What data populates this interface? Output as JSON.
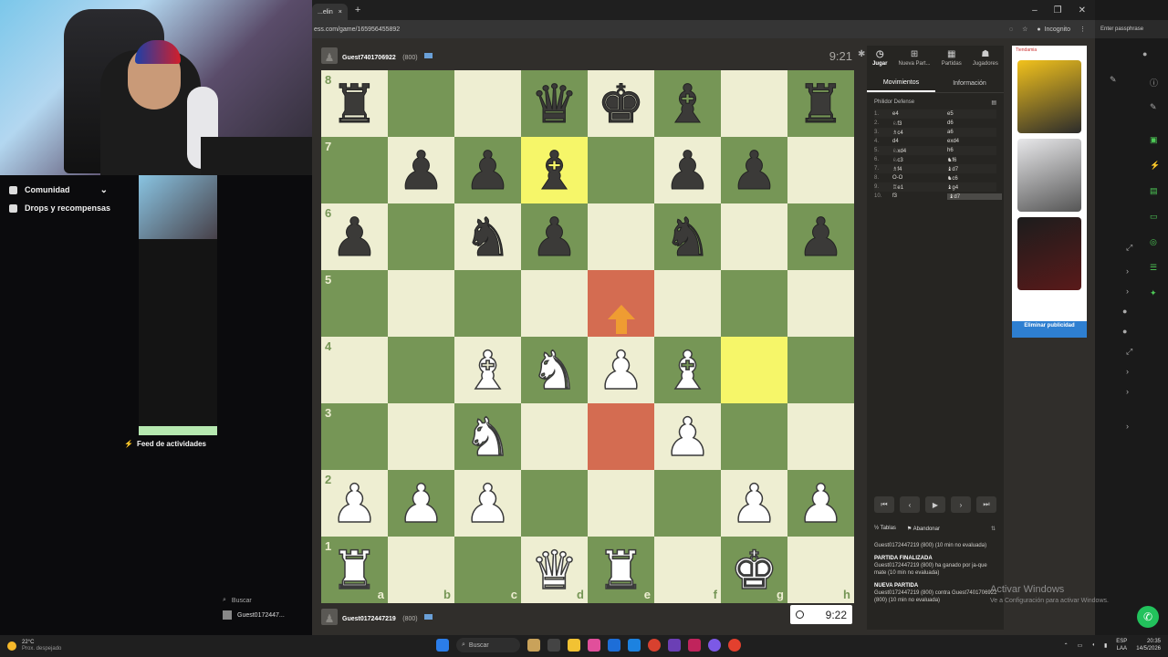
{
  "sidebar": {
    "items": [
      {
        "label": "Comunidad",
        "icon": "people-icon",
        "chevron": "⌄"
      },
      {
        "label": "Drops y recompensas",
        "icon": "gift-icon"
      }
    ],
    "feed_label": "Feed de actividades",
    "search_label": "Buscar",
    "search_user": "Guest0172447..."
  },
  "browser": {
    "tab_title": "...elin",
    "tab_close": "×",
    "new_tab": "+",
    "url": "ess.com/game/165956455892",
    "incognito": "Incognito",
    "window_controls": [
      "–",
      "❐",
      "✕"
    ],
    "passphrase": "Enter passphrase"
  },
  "players": {
    "top": {
      "name": "Guest7401706922",
      "rating": "(800)",
      "clock": "9:21"
    },
    "bottom": {
      "name": "Guest0172447219",
      "rating": "(800)",
      "clock": "9:22"
    }
  },
  "board": {
    "ranks": [
      "8",
      "7",
      "6",
      "5",
      "4",
      "3",
      "2",
      "1"
    ],
    "files": [
      "a",
      "b",
      "c",
      "d",
      "e",
      "f",
      "g",
      "h"
    ],
    "rows": [
      [
        "r",
        "",
        "",
        "q",
        "k",
        "b",
        "",
        "r"
      ],
      [
        "",
        "p",
        "p",
        "b",
        "",
        "p",
        "p",
        ""
      ],
      [
        "p",
        "",
        "n",
        "p",
        "",
        "n",
        "",
        "p"
      ],
      [
        "",
        "",
        "",
        "",
        "",
        "",
        "",
        ""
      ],
      [
        "",
        "",
        "B",
        "N",
        "P",
        "B",
        "",
        ""
      ],
      [
        "",
        "",
        "N",
        "",
        "",
        "P",
        "",
        ""
      ],
      [
        "P",
        "P",
        "P",
        "",
        "",
        "",
        "P",
        "P"
      ],
      [
        "R",
        "",
        "",
        "Q",
        "R",
        "",
        "K",
        ""
      ]
    ],
    "highlight_yellow": [
      "d7",
      "g4"
    ],
    "highlight_red": [
      "e5",
      "e3"
    ],
    "arrow_square": "e5"
  },
  "panel": {
    "tabs": [
      {
        "label": "Jugar",
        "icon": "clock-icon",
        "glyph": "◷"
      },
      {
        "label": "Nueva Part...",
        "icon": "plus-icon",
        "glyph": "⊞"
      },
      {
        "label": "Partidas",
        "icon": "grid-icon",
        "glyph": "▦"
      },
      {
        "label": "Jugadores",
        "icon": "players-icon",
        "glyph": "☗"
      }
    ],
    "subtabs": [
      "Movimientos",
      "Información"
    ],
    "opening": "Philidor Defense",
    "moves": [
      {
        "n": "1.",
        "w": "e4",
        "b": "e5"
      },
      {
        "n": "2.",
        "w": "♘f3",
        "b": "d6"
      },
      {
        "n": "3.",
        "w": "♗c4",
        "b": "a6"
      },
      {
        "n": "4.",
        "w": "d4",
        "b": "exd4"
      },
      {
        "n": "5.",
        "w": "♘xd4",
        "b": "h6"
      },
      {
        "n": "6.",
        "w": "♘c3",
        "b": "♞f6"
      },
      {
        "n": "7.",
        "w": "♗f4",
        "b": "♝d7"
      },
      {
        "n": "8.",
        "w": "O-O",
        "b": "♞c6"
      },
      {
        "n": "9.",
        "w": "♖e1",
        "b": "♝g4"
      },
      {
        "n": "10.",
        "w": "f3",
        "b": "♝d7"
      }
    ],
    "nav_buttons": [
      "⏮",
      "‹",
      "▶",
      "›",
      "⏭"
    ],
    "actions": {
      "draw": "Tablas",
      "resign": "Abandonar",
      "flip": "⇅"
    },
    "chat": [
      {
        "type": "line",
        "text": "Guest0172447219 (800) (10 min no evaluada)"
      },
      {
        "type": "head",
        "text": "PARTIDA FINALIZADA"
      },
      {
        "type": "line",
        "text": "Guest0172447219 (800) ha ganado por ja-que mate (10 min no evaluada)"
      },
      {
        "type": "head",
        "text": "NUEVA PARTIDA"
      },
      {
        "type": "line",
        "text": "Guest0172447219 (800) contra Guest7401706922 (800) (10 min no evaluada)"
      }
    ]
  },
  "ad": {
    "tag": "Tiendamia",
    "remove_label": "Eliminar publicidad"
  },
  "system": {
    "activate_title": "Activar Windows",
    "activate_sub": "Ve a Configuración para activar Windows.",
    "weather_temp": "22°C",
    "weather_desc": "Prox. despejado",
    "taskbar_search": "Buscar",
    "lang": "ESP",
    "lang2": "LAA",
    "time": "20:35",
    "date": "14/5/2026"
  }
}
